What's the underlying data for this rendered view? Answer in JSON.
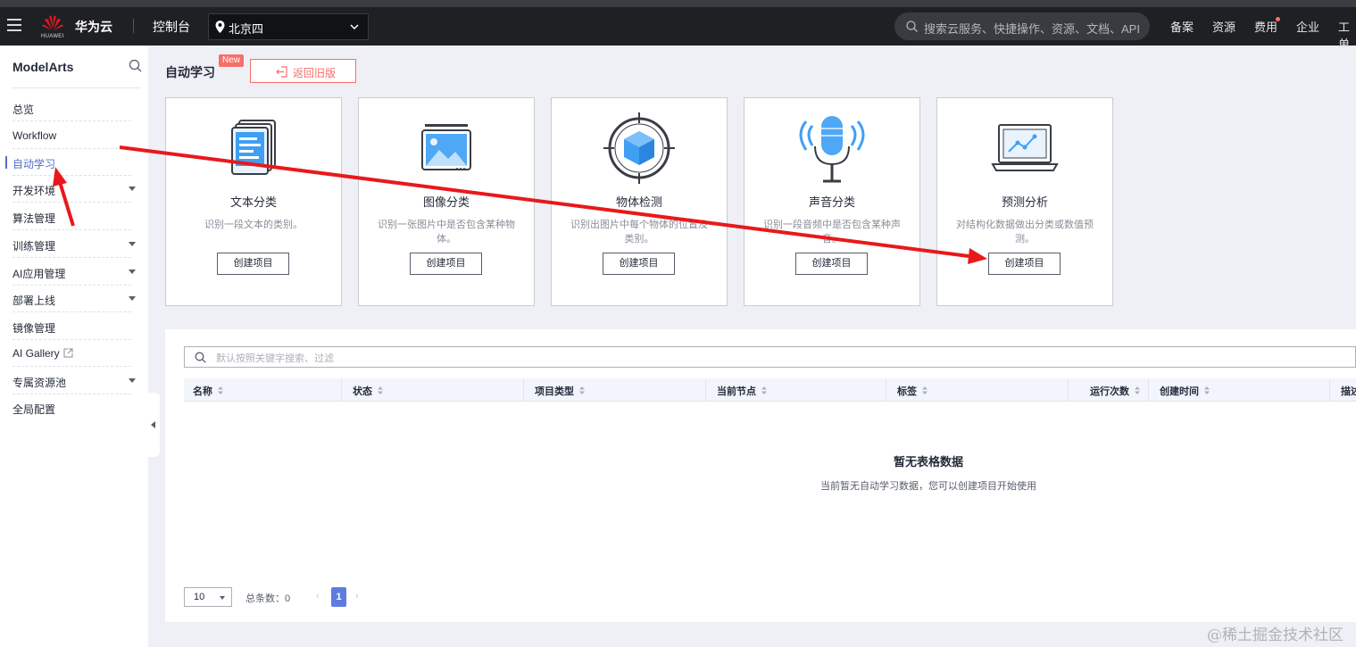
{
  "topbar": {
    "logo_text": "HUAWEI",
    "brand": "华为云",
    "console": "控制台",
    "region": "北京四",
    "search_placeholder": "搜索云服务、快捷操作、资源、文档、API",
    "nav": [
      "备案",
      "资源",
      "费用",
      "企业",
      "工单"
    ]
  },
  "sidebar": {
    "title": "ModelArts",
    "items": [
      {
        "label": "总览",
        "expandable": false
      },
      {
        "label": "Workflow",
        "expandable": false
      },
      {
        "label": "自动学习",
        "expandable": false,
        "active": true
      },
      {
        "label": "开发环境",
        "expandable": true
      },
      {
        "label": "算法管理",
        "expandable": false
      },
      {
        "label": "训练管理",
        "expandable": true
      },
      {
        "label": "AI应用管理",
        "expandable": true
      },
      {
        "label": "部署上线",
        "expandable": true
      },
      {
        "label": "镜像管理",
        "expandable": false
      },
      {
        "label": "AI Gallery",
        "expandable": false,
        "external": true
      },
      {
        "label": "专属资源池",
        "expandable": true
      },
      {
        "label": "全局配置",
        "expandable": false
      }
    ]
  },
  "page": {
    "title": "自动学习",
    "badge": "New",
    "back_button": "返回旧版"
  },
  "cards": [
    {
      "icon": "document-icon",
      "title": "文本分类",
      "desc": "识别一段文本的类别。",
      "button": "创建项目"
    },
    {
      "icon": "image-icon",
      "title": "图像分类",
      "desc": "识别一张图片中是否包含某种物体。",
      "button": "创建项目"
    },
    {
      "icon": "target-cube-icon",
      "title": "物体检测",
      "desc": "识别出图片中每个物体的位置及类别。",
      "button": "创建项目"
    },
    {
      "icon": "microphone-icon",
      "title": "声音分类",
      "desc": "识别一段音频中是否包含某种声音。",
      "button": "创建项目"
    },
    {
      "icon": "laptop-chart-icon",
      "title": "预测分析",
      "desc": "对结构化数据做出分类或数值预测。",
      "button": "创建项目"
    }
  ],
  "table": {
    "search_placeholder": "默认按照关键字搜索、过滤",
    "columns": [
      "名称",
      "状态",
      "项目类型",
      "当前节点",
      "标签",
      "运行次数",
      "创建时间",
      "描述"
    ],
    "empty_title": "暂无表格数据",
    "empty_desc": "当前暂无自动学习数据，您可以创建项目开始使用"
  },
  "pagination": {
    "page_size": "10",
    "total_label": "总条数：0",
    "current_page": "1",
    "prev": "‹",
    "next": "›"
  },
  "watermark": "@稀土掘金技术社区",
  "colors": {
    "accent": "#526ecc",
    "badge": "#f66f6a",
    "annotation_arrow": "#e8191b",
    "topbar": "#1f2024",
    "icon_blue": "#3f9ff2"
  }
}
